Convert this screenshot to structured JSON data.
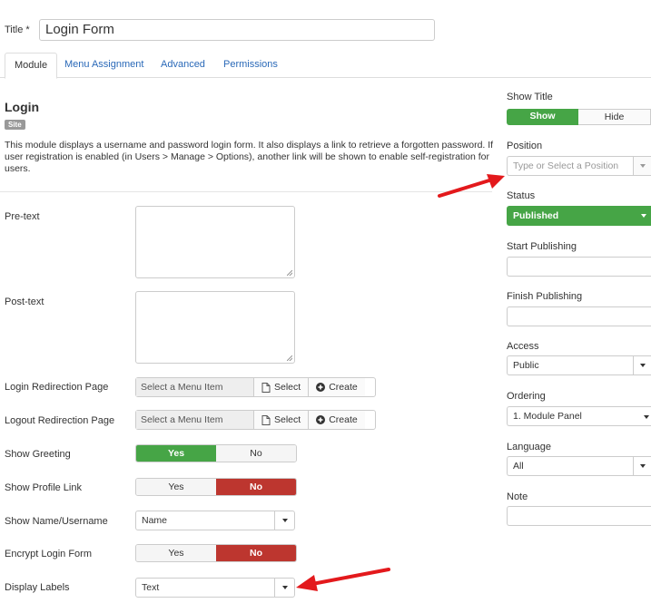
{
  "header": {
    "title_label": "Title *",
    "title_value": "Login Form"
  },
  "tabs": [
    {
      "label": "Module"
    },
    {
      "label": "Menu Assignment"
    },
    {
      "label": "Advanced"
    },
    {
      "label": "Permissions"
    }
  ],
  "module": {
    "name": "Login",
    "badge": "Site",
    "description": "This module displays a username and password login form. It also displays a link to retrieve a forgotten password. If user registration is enabled (in Users > Manage > Options), another link will be shown to enable self-registration for users."
  },
  "fields": {
    "pretext_label": "Pre-text",
    "posttext_label": "Post-text",
    "login_redirect_label": "Login Redirection Page",
    "logout_redirect_label": "Logout Redirection Page",
    "menu_placeholder": "Select a Menu Item",
    "select_label": "Select",
    "create_label": "Create",
    "show_greeting_label": "Show Greeting",
    "show_profile_label": "Show Profile Link",
    "show_name_label": "Show Name/Username",
    "show_name_value": "Name",
    "encrypt_label": "Encrypt Login Form",
    "display_labels_label": "Display Labels",
    "display_labels_value": "Text",
    "yes": "Yes",
    "no": "No",
    "toggles": {
      "show_greeting": "Yes",
      "show_profile": "No",
      "encrypt": "No"
    }
  },
  "sidebar": {
    "show_title_label": "Show Title",
    "show": "Show",
    "hide": "Hide",
    "position_label": "Position",
    "position_placeholder": "Type or Select a Position",
    "status_label": "Status",
    "status_value": "Published",
    "start_publishing_label": "Start Publishing",
    "finish_publishing_label": "Finish Publishing",
    "access_label": "Access",
    "access_value": "Public",
    "ordering_label": "Ordering",
    "ordering_value": "1. Module Panel",
    "language_label": "Language",
    "language_value": "All",
    "note_label": "Note"
  },
  "colors": {
    "green": "#46a546",
    "red": "#bd362f",
    "link": "#2a69b8",
    "annotation_arrow": "#e3191c"
  }
}
